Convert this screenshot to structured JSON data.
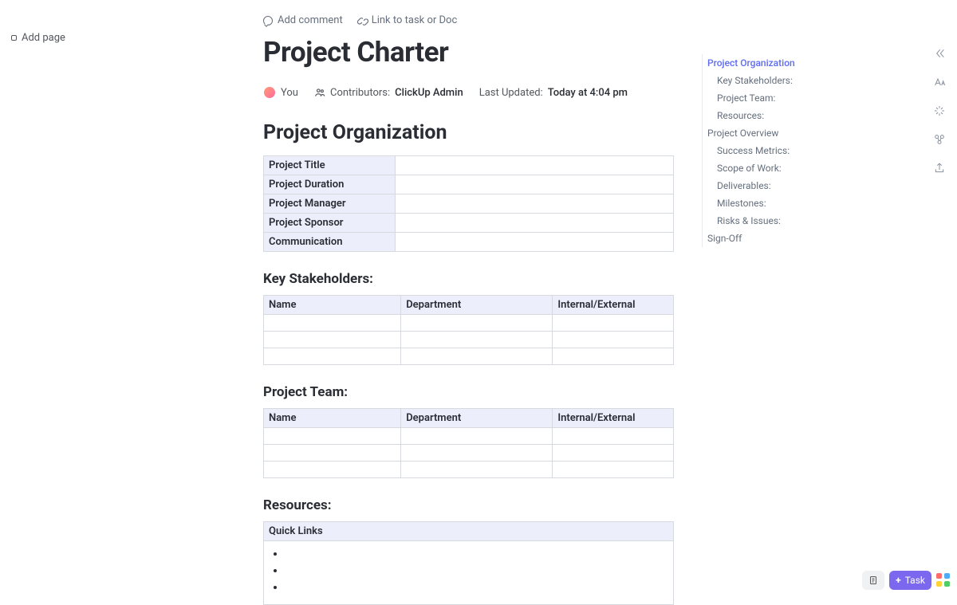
{
  "add_page_label": "Add page",
  "top_actions": {
    "add_comment": "Add comment",
    "link_to_task": "Link to task or Doc"
  },
  "title": "Project Charter",
  "meta": {
    "you_label": "You",
    "contributors_label": "Contributors:",
    "contributors_value": "ClickUp Admin",
    "updated_label": "Last Updated:",
    "updated_value": "Today at 4:04 pm"
  },
  "sections": {
    "org_heading": "Project Organization",
    "org_rows": [
      "Project Title",
      "Project Duration",
      "Project Manager",
      "Project Sponsor",
      "Communication"
    ],
    "stakeholders_heading": "Key Stakeholders:",
    "team_heading": "Project Team:",
    "resources_heading": "Resources:",
    "table_headers": [
      "Name",
      "Department",
      "Internal/External"
    ],
    "quick_links_label": "Quick Links"
  },
  "outline": [
    {
      "label": "Project Organization",
      "level": 1,
      "active": true
    },
    {
      "label": "Key Stakeholders:",
      "level": 2,
      "active": false
    },
    {
      "label": "Project Team:",
      "level": 2,
      "active": false
    },
    {
      "label": "Resources:",
      "level": 2,
      "active": false
    },
    {
      "label": "Project Overview",
      "level": 1,
      "active": false
    },
    {
      "label": "Success Metrics:",
      "level": 2,
      "active": false
    },
    {
      "label": "Scope of Work:",
      "level": 2,
      "active": false
    },
    {
      "label": "Deliverables:",
      "level": 2,
      "active": false
    },
    {
      "label": "Milestones:",
      "level": 2,
      "active": false
    },
    {
      "label": "Risks & Issues:",
      "level": 2,
      "active": false
    },
    {
      "label": "Sign-Off",
      "level": 1,
      "active": false
    }
  ],
  "bottom": {
    "task_label": "Task"
  }
}
